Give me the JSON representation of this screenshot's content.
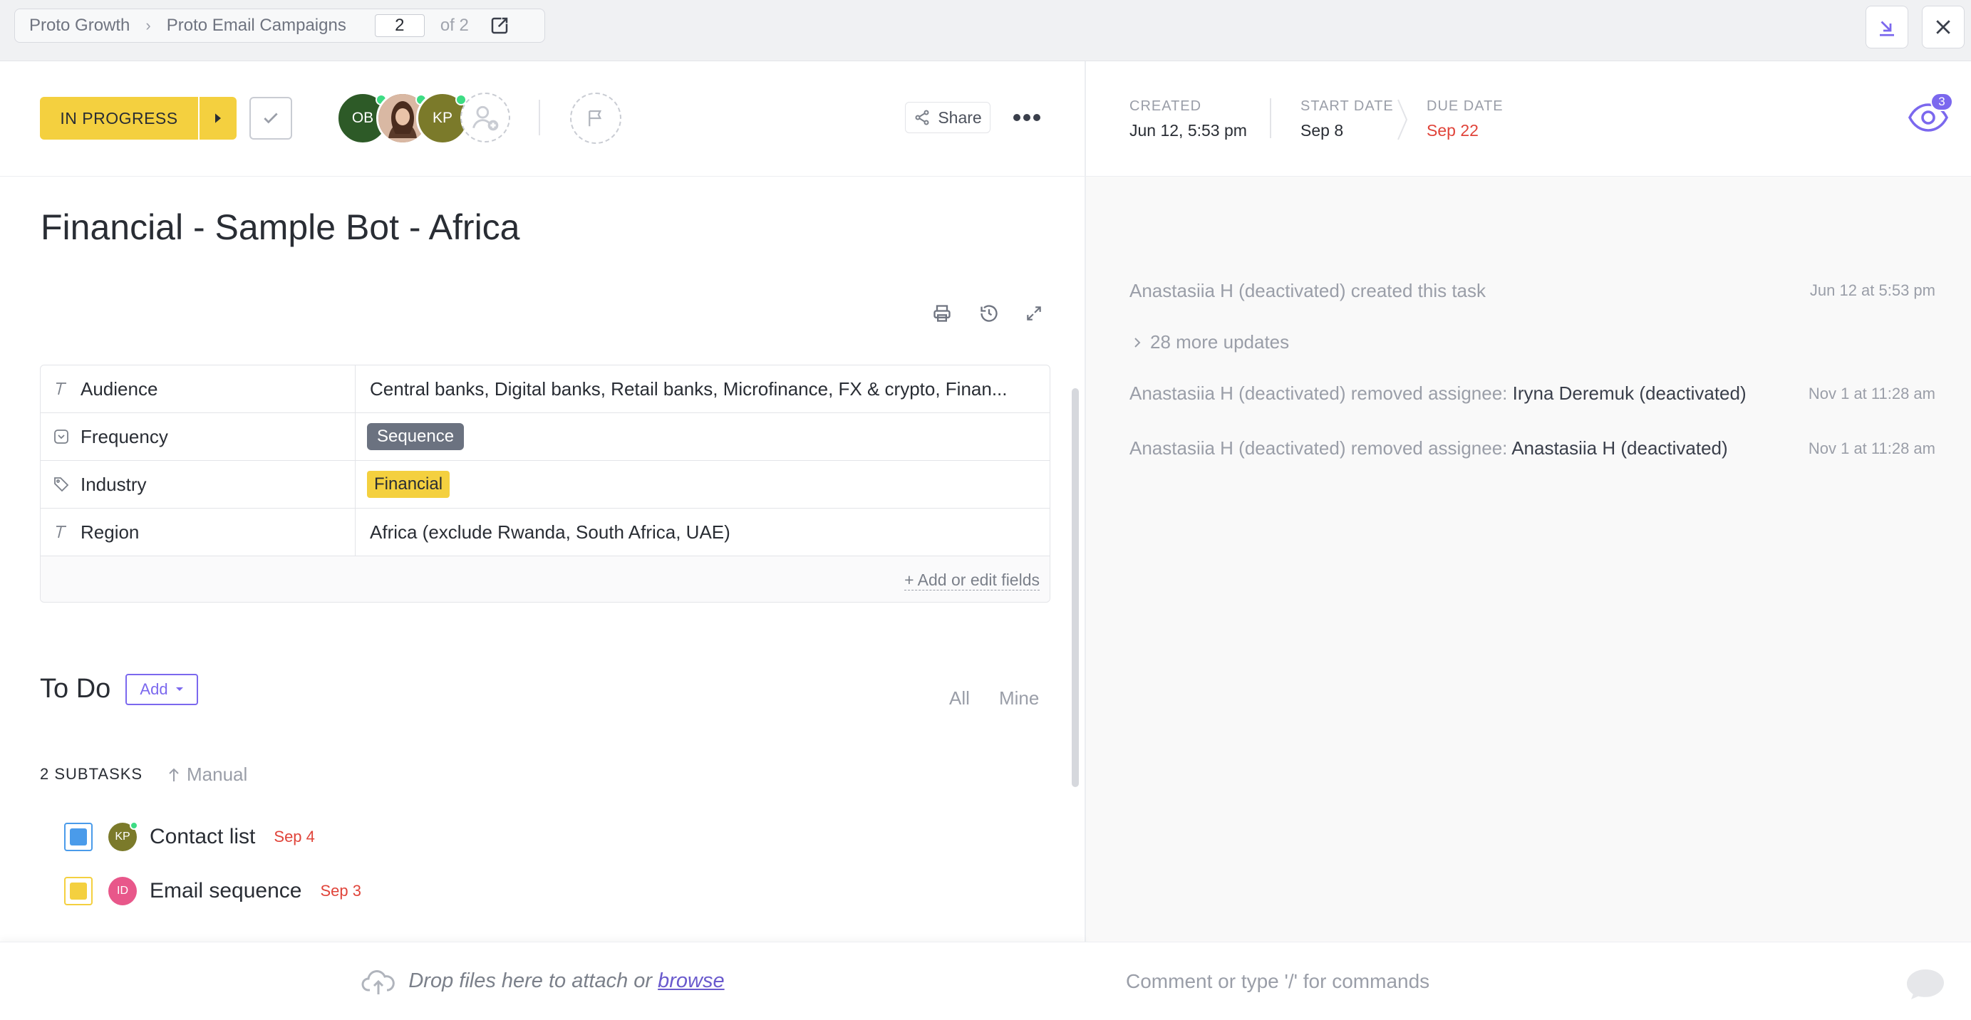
{
  "topbar": {
    "breadcrumb": [
      "Proto Growth",
      "Proto Email Campaigns"
    ],
    "page_current": "2",
    "page_total": "of 2"
  },
  "task": {
    "status": "IN PROGRESS",
    "title": "Financial - Sample Bot - Africa",
    "assignees": [
      {
        "initials": "OB",
        "color": "#2d5a27"
      },
      {
        "initials": "",
        "color": "#b07a5a"
      },
      {
        "initials": "KP",
        "color": "#7b7a2a"
      }
    ],
    "share_label": "Share"
  },
  "fields": [
    {
      "name": "Audience",
      "icon": "text-icon",
      "value": "Central banks, Digital banks, Retail banks, Microfinance, FX & crypto, Finan..."
    },
    {
      "name": "Frequency",
      "icon": "dropdown-icon",
      "value": "Sequence"
    },
    {
      "name": "Industry",
      "icon": "tag-icon",
      "value": "Financial"
    },
    {
      "name": "Region",
      "icon": "text-icon",
      "value": "Africa (exclude Rwanda, South Africa, UAE)"
    }
  ],
  "fields_add_label": "+ Add or edit fields",
  "todo": {
    "title": "To Do",
    "add_label": "Add",
    "filter_all": "All",
    "filter_mine": "Mine",
    "subtasks_header": "2 SUBTASKS",
    "sort_label": "Manual",
    "subtasks": [
      {
        "name": "Contact list",
        "date": "Sep 4",
        "status_color": "#4a9bea",
        "avatar": "KP",
        "avatar_color": "#7b7a2a"
      },
      {
        "name": "Email sequence",
        "date": "Sep 3",
        "status_color": "#f4d03f",
        "avatar": "ID",
        "avatar_color": "#e8578a"
      }
    ]
  },
  "drop": {
    "text": "Drop files here to attach or",
    "browse": "browse"
  },
  "meta": {
    "created_label": "CREATED",
    "created_value": "Jun 12, 5:53 pm",
    "start_label": "START DATE",
    "start_value": "Sep 8",
    "due_label": "DUE DATE",
    "due_value": "Sep 22",
    "watchers": "3"
  },
  "activity": {
    "created": {
      "text": "Anastasiia H (deactivated) created this task",
      "time": "Jun 12 at 5:53 pm"
    },
    "more_updates": "28 more updates",
    "items": [
      {
        "text": "Anastasiia H (deactivated) removed assignee: ",
        "target": "Iryna Deremuk (deactivated)",
        "time": "Nov 1 at 11:28 am"
      },
      {
        "text": "Anastasiia H (deactivated) removed assignee: ",
        "target": "Anastasiia H (deactivated)",
        "time": "Nov 1 at 11:28 am"
      }
    ]
  },
  "comment": {
    "placeholder": "Comment or type '/' for commands"
  }
}
